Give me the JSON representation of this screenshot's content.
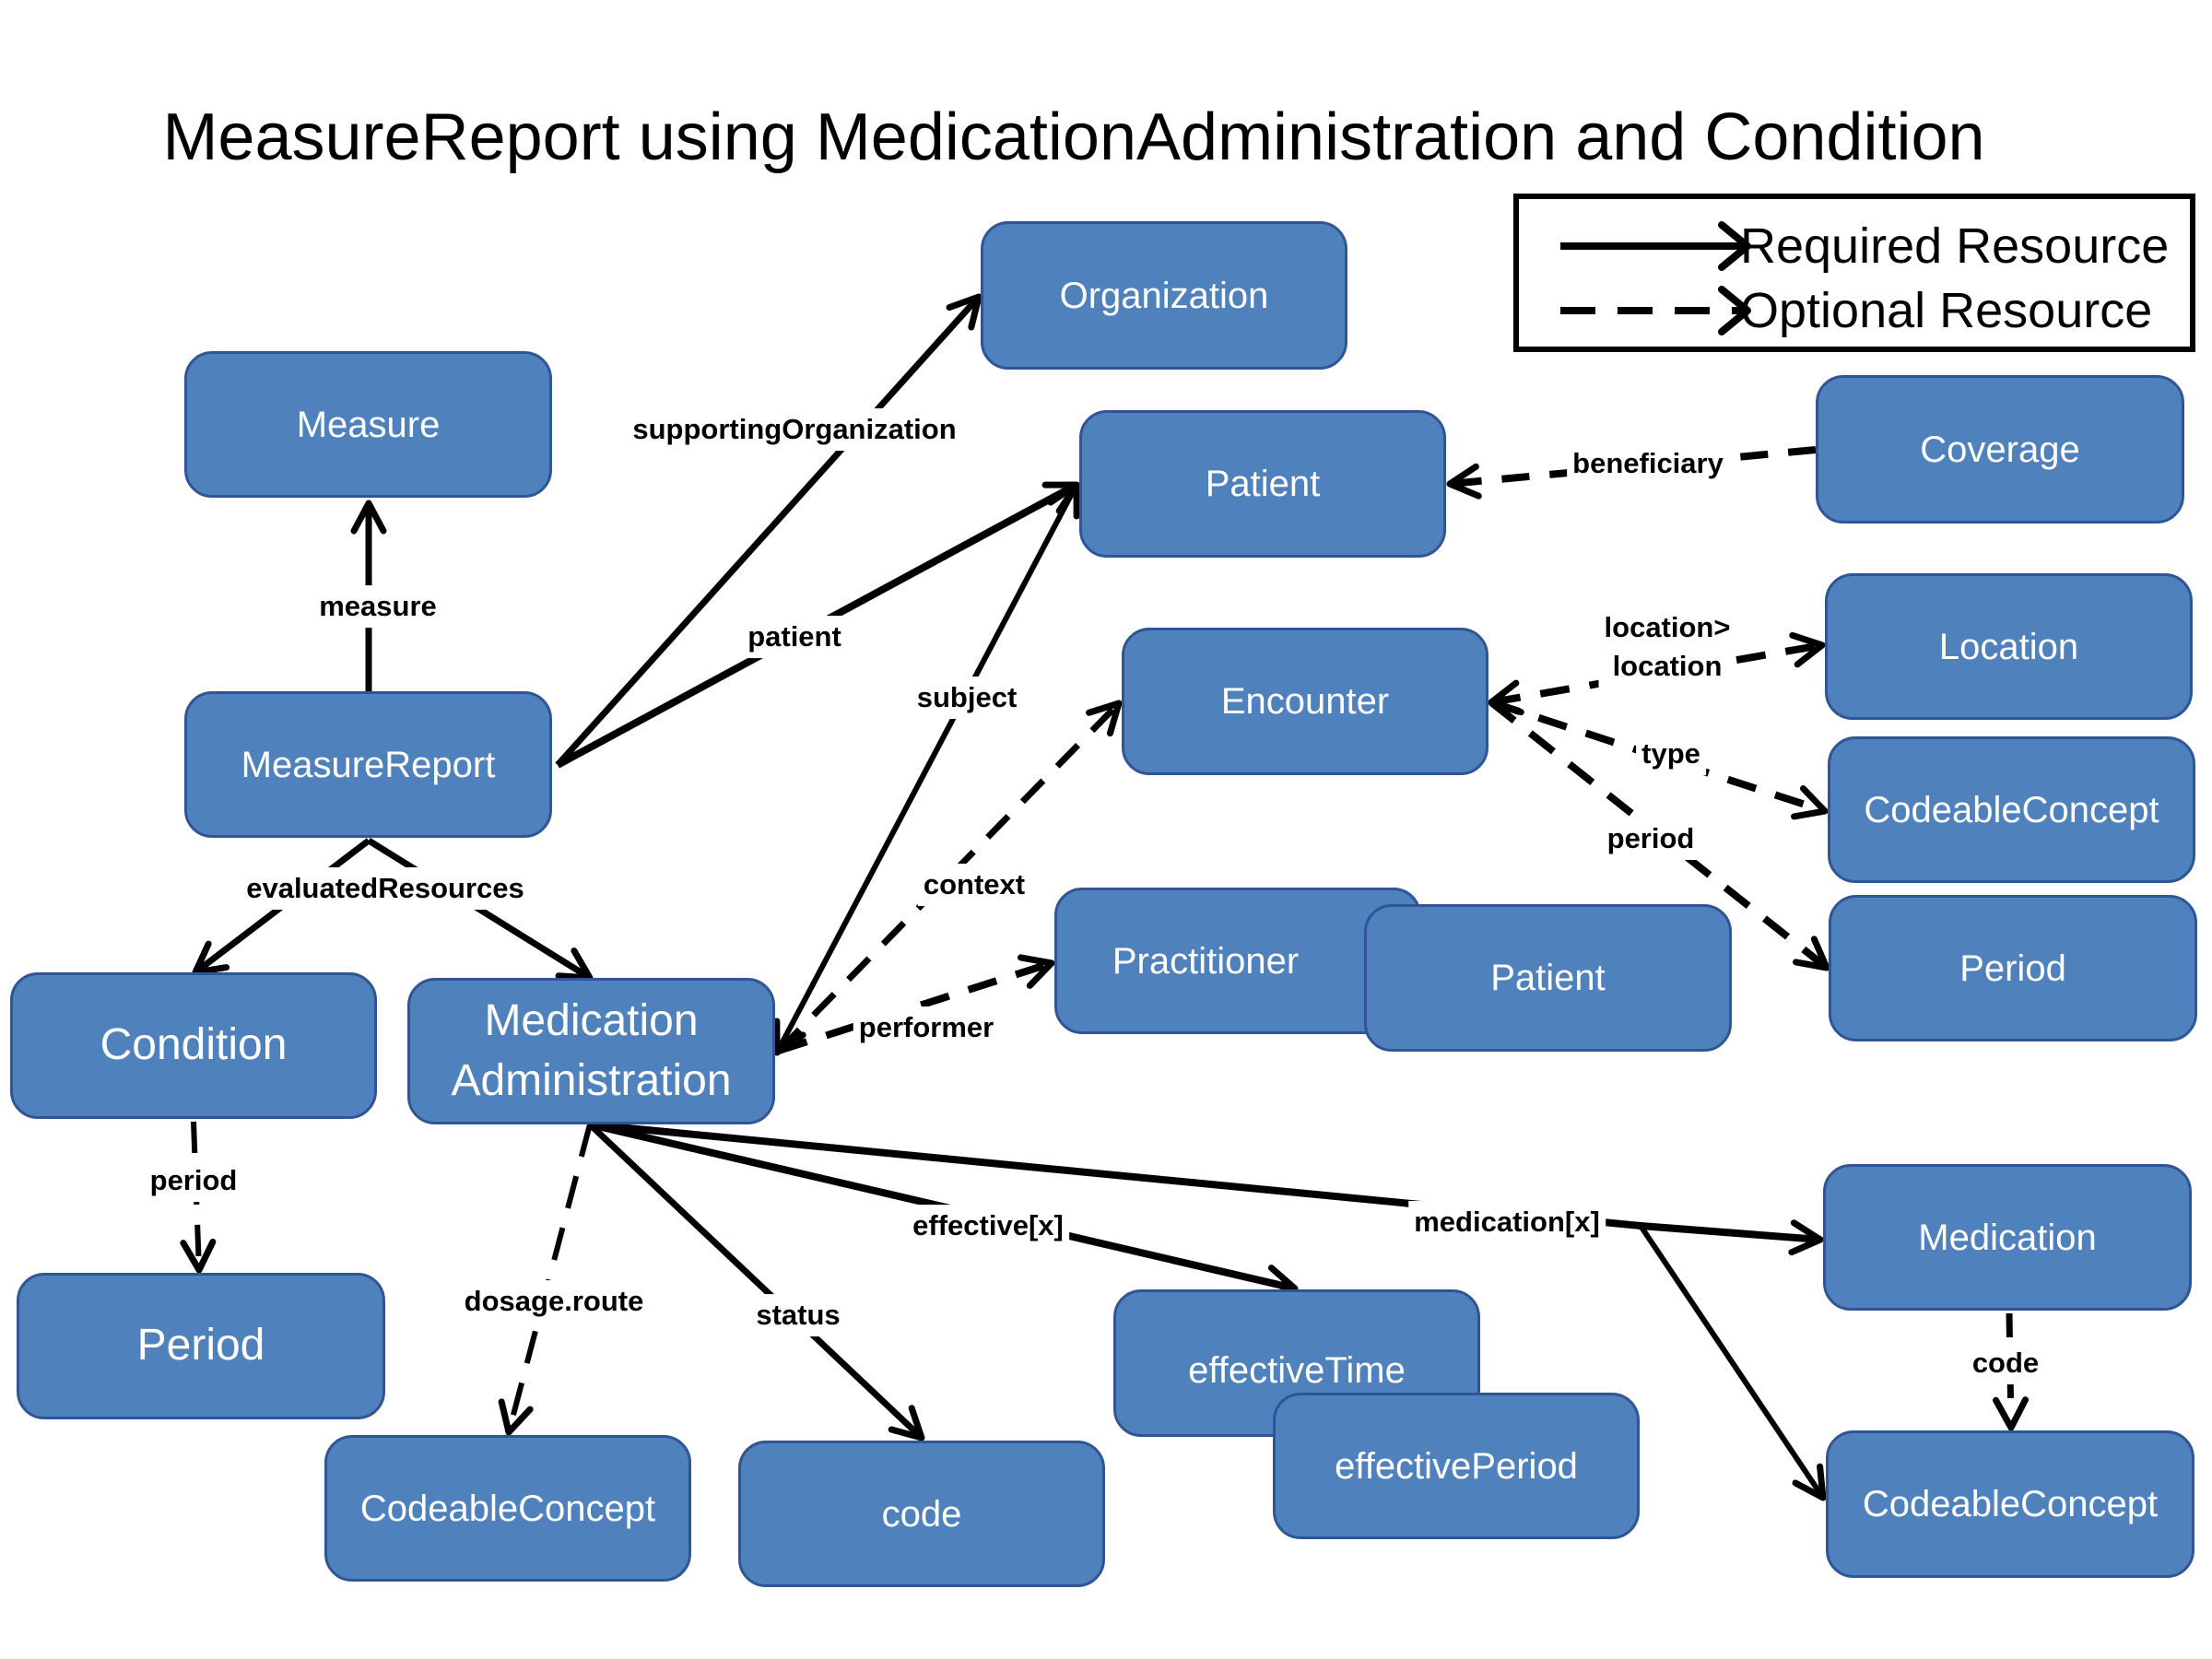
{
  "title": "MeasureReport using MedicationAdministration and Condition",
  "colors": {
    "node_fill": "#4f81bd",
    "node_border": "#2f5597",
    "node_text": "#ffffff",
    "edge": "#000000"
  },
  "legend": {
    "items": [
      {
        "label": "Required Resource",
        "style": "solid"
      },
      {
        "label": "Optional Resource",
        "style": "dashed"
      }
    ]
  },
  "nodes": [
    {
      "id": "organization",
      "label": "Organization"
    },
    {
      "id": "measure",
      "label": "Measure"
    },
    {
      "id": "patient",
      "label": "Patient"
    },
    {
      "id": "coverage",
      "label": "Coverage"
    },
    {
      "id": "measurereport",
      "label": "MeasureReport"
    },
    {
      "id": "encounter",
      "label": "Encounter"
    },
    {
      "id": "location",
      "label": "Location"
    },
    {
      "id": "enc_codeableconcept",
      "label": "CodeableConcept"
    },
    {
      "id": "practitioner",
      "label": "Practitioner"
    },
    {
      "id": "performer_patient",
      "label": "Patient"
    },
    {
      "id": "enc_period",
      "label": "Period"
    },
    {
      "id": "condition",
      "label": "Condition"
    },
    {
      "id": "medicationadministration",
      "label": "Medication\nAdministration"
    },
    {
      "id": "cond_period",
      "label": "Period"
    },
    {
      "id": "medication",
      "label": "Medication"
    },
    {
      "id": "effectivetime",
      "label": "effectiveTime"
    },
    {
      "id": "effectiveperiod",
      "label": "effectivePeriod"
    },
    {
      "id": "dosage_codeableconcept",
      "label": "CodeableConcept"
    },
    {
      "id": "status_code",
      "label": "code"
    },
    {
      "id": "med_codeableconcept",
      "label": "CodeableConcept"
    }
  ],
  "edges": [
    {
      "from": "measurereport",
      "to": "measure",
      "label": "measure",
      "style": "solid"
    },
    {
      "from": "measurereport",
      "to": "organization",
      "label": "supportingOrganization",
      "style": "solid"
    },
    {
      "from": "measurereport",
      "to": "patient",
      "label": "patient",
      "style": "solid"
    },
    {
      "from": "measurereport",
      "to": "condition",
      "label": "evaluatedResources",
      "style": "solid"
    },
    {
      "from": "measurereport",
      "to": "medicationadministration",
      "label": "evaluatedResources",
      "style": "solid"
    },
    {
      "from": "coverage",
      "to": "patient",
      "label": "beneficiary",
      "style": "dashed"
    },
    {
      "from": "medicationadministration",
      "to": "patient",
      "label": "subject",
      "style": "solid"
    },
    {
      "from": "medicationadministration",
      "to": "encounter",
      "label": "context",
      "style": "dashed"
    },
    {
      "from": "medicationadministration",
      "to": "practitioner",
      "label": "performer",
      "style": "dashed"
    },
    {
      "from": "encounter",
      "to": "location",
      "label": "location>\nlocation",
      "style": "dashed"
    },
    {
      "from": "encounter",
      "to": "enc_codeableconcept",
      "label": "type",
      "style": "dashed"
    },
    {
      "from": "encounter",
      "to": "enc_period",
      "label": "period",
      "style": "dashed"
    },
    {
      "from": "condition",
      "to": "cond_period",
      "label": "period",
      "style": "dashed"
    },
    {
      "from": "medicationadministration",
      "to": "dosage_codeableconcept",
      "label": "dosage.route",
      "style": "dashed"
    },
    {
      "from": "medicationadministration",
      "to": "status_code",
      "label": "status",
      "style": "solid"
    },
    {
      "from": "medicationadministration",
      "to": "effectivetime",
      "label": "effective[x]",
      "style": "solid"
    },
    {
      "from": "medicationadministration",
      "to": "medication",
      "label": "medication[x]",
      "style": "solid"
    },
    {
      "from": "medicationadministration",
      "to": "med_codeableconcept",
      "label": "medication[x]",
      "style": "solid"
    },
    {
      "from": "medication",
      "to": "med_codeableconcept",
      "label": "code",
      "style": "dashed"
    }
  ]
}
